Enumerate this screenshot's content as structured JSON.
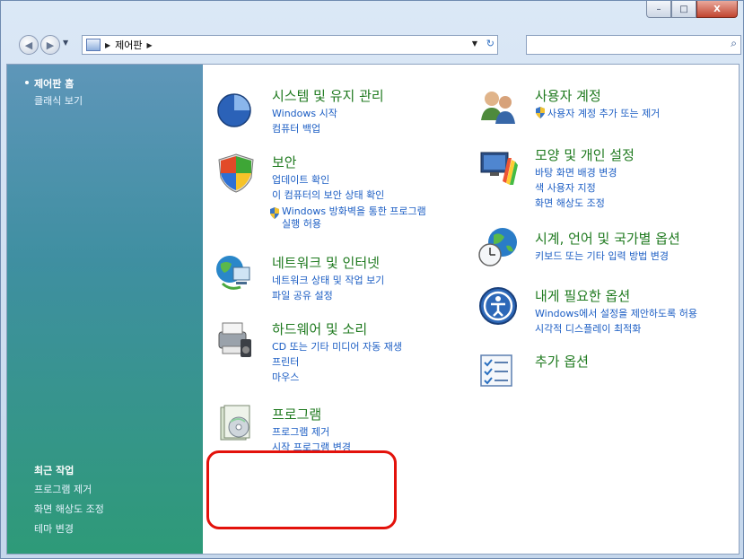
{
  "window": {
    "controls": {
      "minimize": "–",
      "maximize": "□",
      "close": "X"
    }
  },
  "address": {
    "breadcrumb": "제어판",
    "search_placeholder": ""
  },
  "sidebar": {
    "items": [
      {
        "label": "제어판 홈",
        "active": true
      },
      {
        "label": "클래식 보기",
        "active": false
      }
    ],
    "recent": {
      "heading": "최근 작업",
      "items": [
        "프로그램 제거",
        "화면 해상도 조정",
        "테마 변경"
      ]
    }
  },
  "categories": {
    "system": {
      "title": "시스템 및 유지 관리",
      "links": [
        "Windows 시작",
        "컴퓨터 백업"
      ],
      "icon": "system-maintenance-icon"
    },
    "security": {
      "title": "보안",
      "links": [
        "업데이트 확인",
        "이 컴퓨터의 보안 상태 확인"
      ],
      "shield_link_line1": "Windows 방화벽을 통한 프로그램",
      "shield_link_line2": "실행 허용",
      "icon": "security-shield-icon"
    },
    "network": {
      "title": "네트워크 및 인터넷",
      "links": [
        "네트워크 상태 및 작업 보기",
        "파일 공유 설정"
      ],
      "icon": "network-icon"
    },
    "hardware": {
      "title": "하드웨어 및 소리",
      "links": [
        "CD 또는 기타 미디어 자동 재생",
        "프린터",
        "마우스"
      ],
      "icon": "hardware-sound-icon"
    },
    "programs": {
      "title": "프로그램",
      "links": [
        "프로그램 제거",
        "시작 프로그램 변경"
      ],
      "icon": "programs-icon"
    },
    "users": {
      "title": "사용자 계정",
      "shield_link": "사용자 계정 추가 또는 제거",
      "icon": "user-accounts-icon"
    },
    "appearance": {
      "title": "모양 및 개인 설정",
      "links": [
        "바탕 화면 배경 변경",
        "색 사용자 지정",
        "화면 해상도 조정"
      ],
      "icon": "appearance-icon"
    },
    "clock": {
      "title": "시계, 언어 및 국가별 옵션",
      "links": [
        "키보드 또는 기타 입력 방법 변경"
      ],
      "icon": "clock-language-icon"
    },
    "ease": {
      "title": "내게 필요한 옵션",
      "links": [
        "Windows에서 설정을 제안하도록 허용",
        "시각적 디스플레이 최적화"
      ],
      "icon": "ease-of-access-icon"
    },
    "additional": {
      "title": "추가 옵션",
      "icon": "additional-options-icon"
    }
  },
  "colors": {
    "highlight": "#e3120b",
    "title_green": "#1f7a1f",
    "link_blue": "#1c5ec4"
  }
}
